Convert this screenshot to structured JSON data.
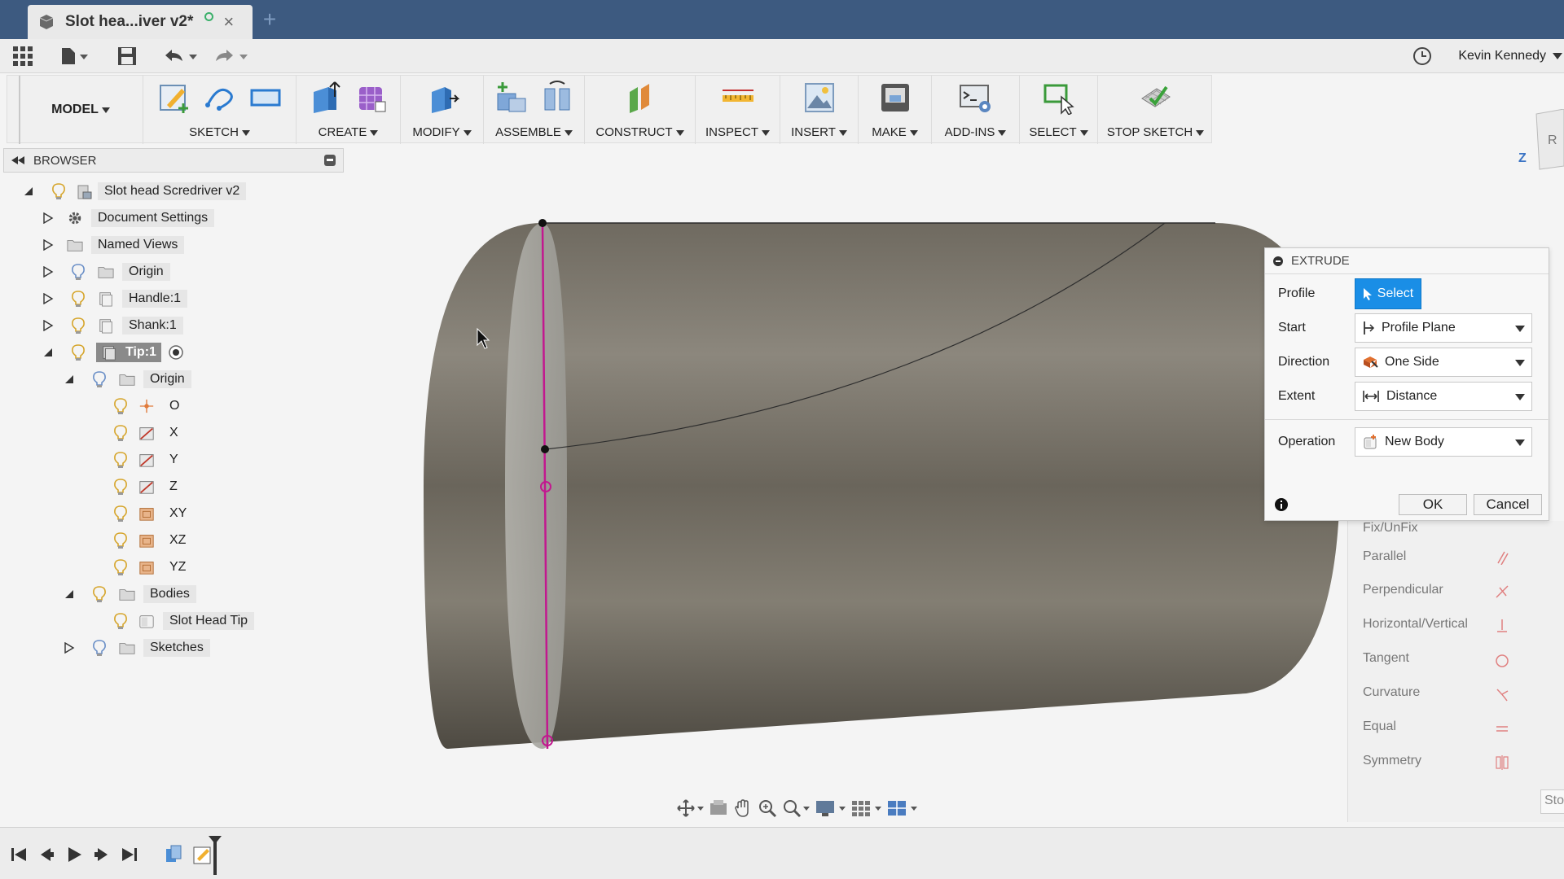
{
  "tab": {
    "title": "Slot hea...iver v2*",
    "new_tab": "+",
    "close": "×"
  },
  "user": {
    "name": "Kevin Kennedy"
  },
  "workspace": {
    "label": "MODEL"
  },
  "ribbon": [
    {
      "label": "SKETCH"
    },
    {
      "label": "CREATE"
    },
    {
      "label": "MODIFY"
    },
    {
      "label": "ASSEMBLE"
    },
    {
      "label": "CONSTRUCT"
    },
    {
      "label": "INSPECT"
    },
    {
      "label": "INSERT"
    },
    {
      "label": "MAKE"
    },
    {
      "label": "ADD-INS"
    },
    {
      "label": "SELECT"
    },
    {
      "label": "STOP SKETCH"
    }
  ],
  "browser": {
    "title": "BROWSER",
    "items": [
      {
        "label": "Slot head Scredriver v2"
      },
      {
        "label": "Document Settings"
      },
      {
        "label": "Named Views"
      },
      {
        "label": "Origin"
      },
      {
        "label": "Handle:1"
      },
      {
        "label": "Shank:1"
      },
      {
        "label": "Tip:1"
      },
      {
        "label": "Origin"
      },
      {
        "label": "O"
      },
      {
        "label": "X"
      },
      {
        "label": "Y"
      },
      {
        "label": "Z"
      },
      {
        "label": "XY"
      },
      {
        "label": "XZ"
      },
      {
        "label": "YZ"
      },
      {
        "label": "Bodies"
      },
      {
        "label": "Slot Head Tip"
      },
      {
        "label": "Sketches"
      }
    ]
  },
  "extrude": {
    "title": "EXTRUDE",
    "profile_label": "Profile",
    "profile_button": "Select",
    "start_label": "Start",
    "start_value": "Profile Plane",
    "direction_label": "Direction",
    "direction_value": "One Side",
    "extent_label": "Extent",
    "extent_value": "Distance",
    "operation_label": "Operation",
    "operation_value": "New Body",
    "ok": "OK",
    "cancel": "Cancel"
  },
  "constraints": {
    "items": [
      {
        "label": "Fix/UnFix"
      },
      {
        "label": "Parallel"
      },
      {
        "label": "Perpendicular"
      },
      {
        "label": "Horizontal/Vertical"
      },
      {
        "label": "Tangent"
      },
      {
        "label": "Curvature"
      },
      {
        "label": "Equal"
      },
      {
        "label": "Symmetry"
      }
    ],
    "stop_label": "Sto"
  },
  "viewcube": {
    "axis_label": "Z",
    "face_label": "R"
  },
  "colors": {
    "titlebar": "#3d5a80",
    "accent": "#1a8ee6",
    "sketch_line": "#c2188f"
  }
}
